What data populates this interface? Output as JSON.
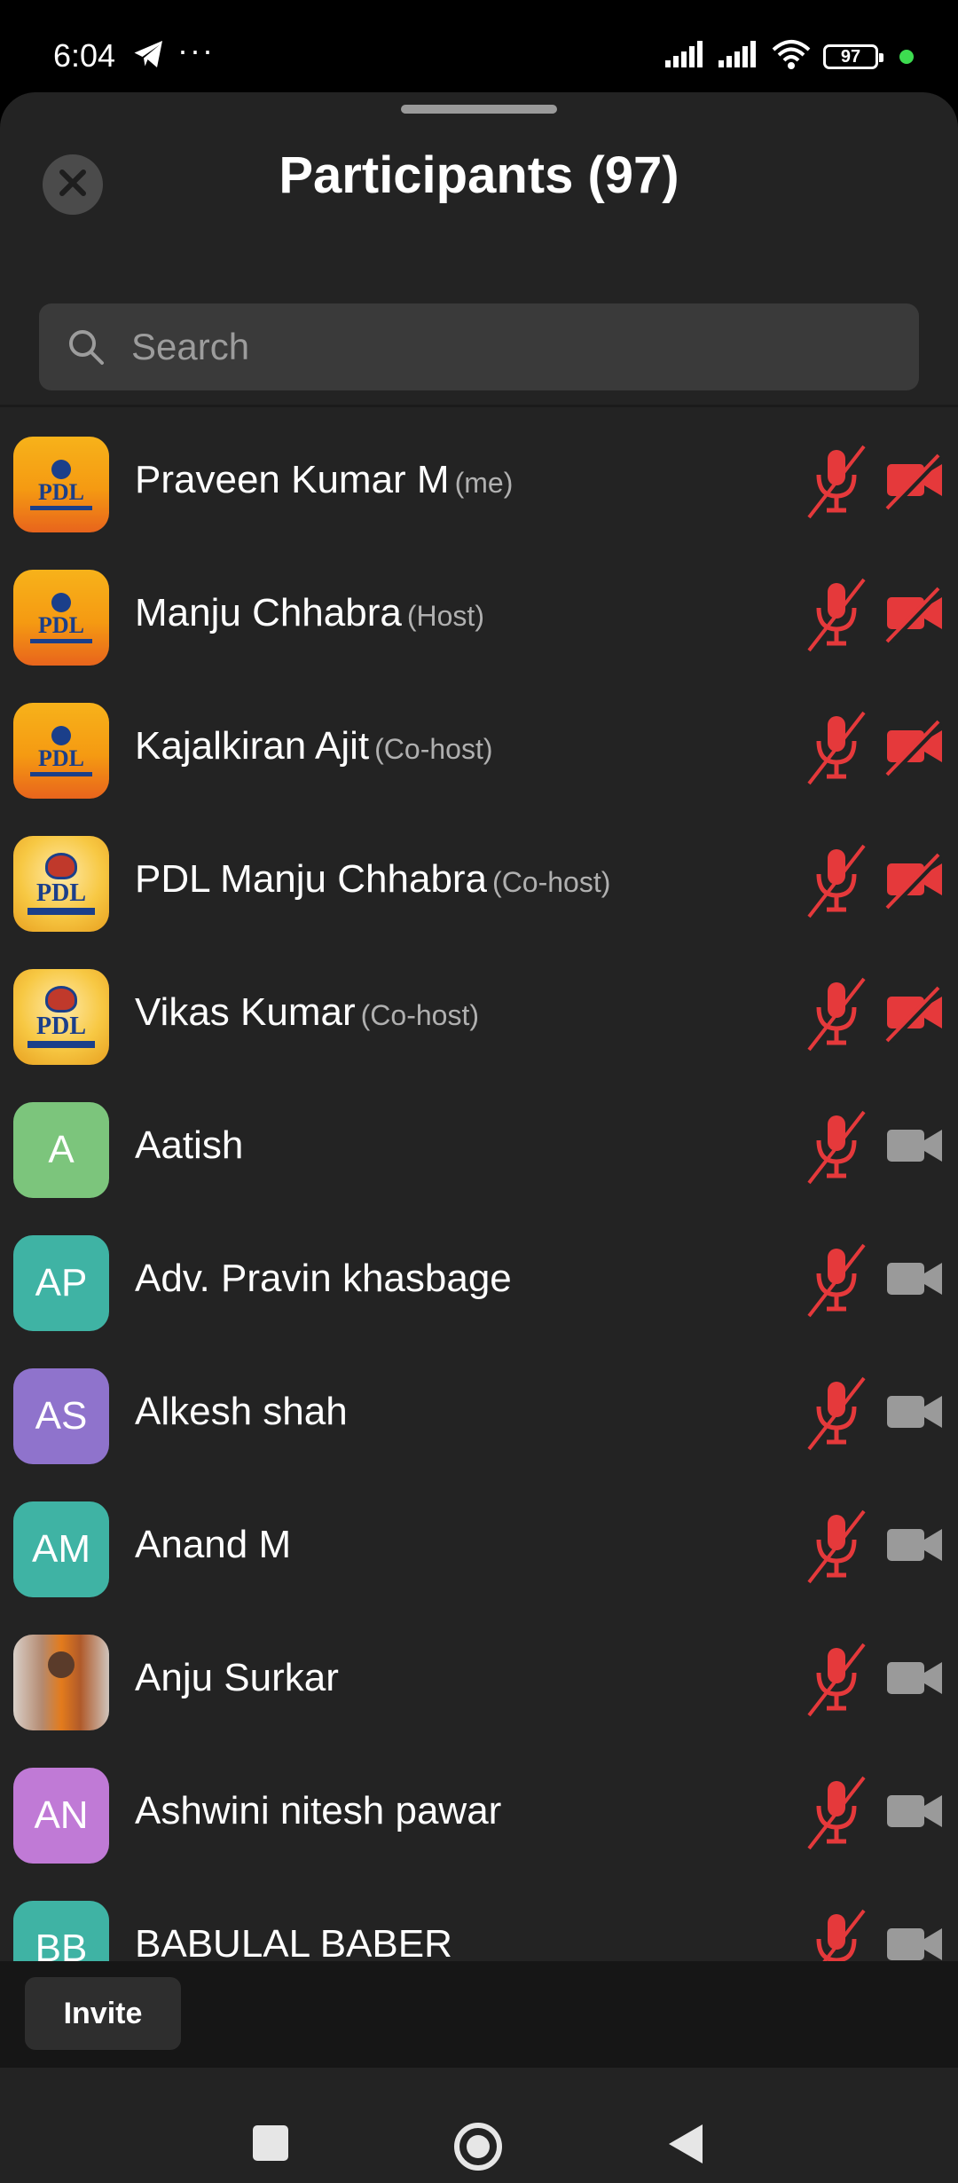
{
  "status_bar": {
    "time": "6:04",
    "more": "···",
    "battery": "97"
  },
  "header": {
    "title": "Participants (97)"
  },
  "search": {
    "placeholder": "Search"
  },
  "participants": [
    {
      "name": "Praveen Kumar M",
      "role": "(me)",
      "avatar": "PDL",
      "avatar_kind": "logo-sunset",
      "camera": "off"
    },
    {
      "name": "Manju Chhabra",
      "role": "(Host)",
      "avatar": "PDL",
      "avatar_kind": "logo-sunset",
      "camera": "off"
    },
    {
      "name": "Kajalkiran Ajit",
      "role": "(Co-host)",
      "avatar": "PDL",
      "avatar_kind": "logo-sunset",
      "camera": "off"
    },
    {
      "name": "PDL Manju Chhabra",
      "role": "(Co-host)",
      "avatar": "PDL",
      "avatar_kind": "logo-institute",
      "camera": "off"
    },
    {
      "name": "Vikas Kumar",
      "role": "(Co-host)",
      "avatar": "PDL",
      "avatar_kind": "logo-institute",
      "camera": "off"
    },
    {
      "name": "Aatish",
      "role": "",
      "avatar": "A",
      "avatar_color": "#7cc57c",
      "camera": "available"
    },
    {
      "name": "Adv. Pravin khasbage",
      "role": "",
      "avatar": "AP",
      "avatar_color": "#3fb3a4",
      "camera": "available"
    },
    {
      "name": "Alkesh shah",
      "role": "",
      "avatar": "AS",
      "avatar_color": "#8f73cc",
      "camera": "available"
    },
    {
      "name": "Anand M",
      "role": "",
      "avatar": "AM",
      "avatar_color": "#3fb3a4",
      "camera": "available"
    },
    {
      "name": "Anju Surkar",
      "role": "",
      "avatar": "",
      "avatar_kind": "photo",
      "camera": "available"
    },
    {
      "name": "Ashwini nitesh pawar",
      "role": "",
      "avatar": "AN",
      "avatar_color": "#c07ad6",
      "camera": "available"
    },
    {
      "name": "BABULAL BABER",
      "role": "",
      "avatar": "BB",
      "avatar_color": "#3fb3a4",
      "camera": "available"
    }
  ],
  "footer": {
    "invite_label": "Invite"
  },
  "colors": {
    "muted_red": "#e5393b",
    "camera_gray": "#9a9a9a",
    "sheet_bg": "#232323"
  }
}
